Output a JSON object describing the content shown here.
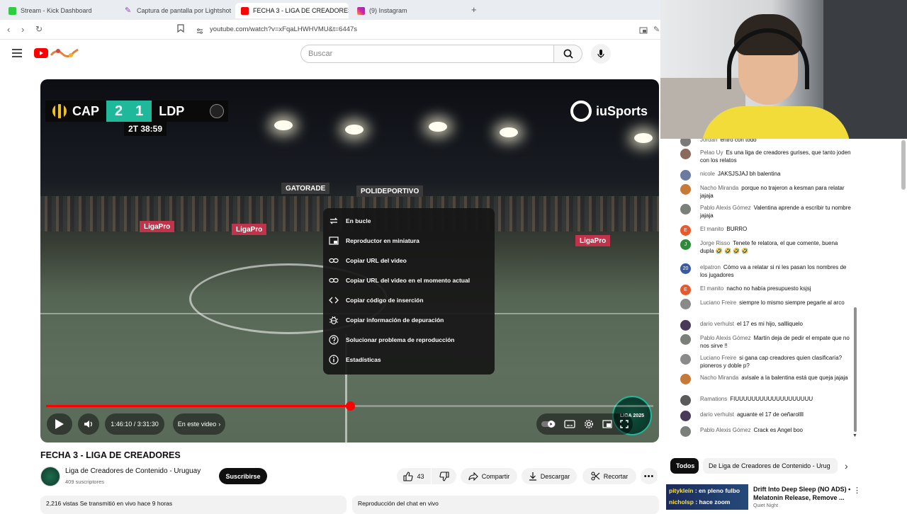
{
  "browser": {
    "tabs": [
      {
        "label": "Stream - Kick Dashboard",
        "color": "#2ecc40"
      },
      {
        "label": "Captura de pantalla por Lightshot",
        "color": "#8e44ad"
      },
      {
        "label": "FECHA 3 - LIGA DE CREADORES",
        "color": "#ff0000"
      },
      {
        "label": "(9) Instagram",
        "color": "#d6249f"
      }
    ],
    "url": "youtube.com/watch?v=xFqaLHWHVMU&t=6447s"
  },
  "header": {
    "search_placeholder": "Buscar"
  },
  "video": {
    "scoreboard": {
      "home": "CAP",
      "home_score": "2",
      "away_score": "1",
      "away": "LDP",
      "clock": "2T 38:59"
    },
    "broadcaster": "iuSports",
    "ad_boards": [
      "GATORADE",
      "POLIDEPORTIVO",
      "LigaPro",
      "LigaPro",
      "LigaPro"
    ],
    "league_badge": "LIGA 2025",
    "time_display": "1:46:10 / 3:31:30",
    "progress": 0.5,
    "chapter_label": "En este video",
    "context_menu": [
      {
        "label": "En bucle",
        "icon": "loop-icon"
      },
      {
        "label": "Reproductor en miniatura",
        "icon": "miniplayer-icon"
      },
      {
        "label": "Copiar URL del video",
        "icon": "link-icon"
      },
      {
        "label": "Copiar URL del video en el momento actual",
        "icon": "link-icon"
      },
      {
        "label": "Copiar código de inserción",
        "icon": "code-icon"
      },
      {
        "label": "Copiar información de depuración",
        "icon": "bug-icon"
      },
      {
        "label": "Solucionar problema de reproducción",
        "icon": "help-icon"
      },
      {
        "label": "Estadísticas",
        "icon": "info-icon"
      }
    ]
  },
  "below_video": {
    "title": "FECHA 3 - LIGA DE CREADORES",
    "channel_name": "Liga de Creadores de Contenido - Uruguay",
    "subscribers": "409 suscriptores",
    "subscribe_label": "Suscribirse",
    "likes": "43",
    "share_label": "Compartir",
    "download_label": "Descargar",
    "clip_label": "Recortar",
    "views_meta": "2,216 vistas  Se transmitió en vivo hace 9 horas",
    "chat_replay_label": "Reproducción del chat en vivo"
  },
  "chat": {
    "messages": [
      {
        "author": "Jordan",
        "text": "entro con todo",
        "avatar": "",
        "color": "#7a7a7a"
      },
      {
        "author": "Pelao Uy",
        "text": "Es una liga de creadores gurises, que tanto joden con los relatos",
        "avatar": "",
        "color": "#8a6a5a"
      },
      {
        "author": "nicole",
        "text": "JAKSJSJAJ bh balentina",
        "avatar": "",
        "color": "#6b7aa0"
      },
      {
        "author": "Nacho Miranda",
        "text": "porque no trajeron a kesman para relatar jajaja",
        "avatar": "",
        "color": "#c67a3a"
      },
      {
        "author": "Pablo Alexis Gómez",
        "text": "Valentina aprende a escribir tu nombre jajaja",
        "avatar": "",
        "color": "#7a7f7a"
      },
      {
        "author": "El manito",
        "text": "BURRO",
        "avatar": "E",
        "color": "#e8582a"
      },
      {
        "author": "Jorge Risso",
        "text": "Tenete fe relatora, el que comente, buena dupla 🤣 🤣 🤣 🤣",
        "avatar": "J",
        "color": "#2e8b3a"
      },
      {
        "author": "elpatron",
        "text": "Cómo va a relatar si ni les pasan los nombres de los jugadores",
        "avatar": "20",
        "color": "#3a5aa0"
      },
      {
        "author": "El manito",
        "text": "nacho no había presupuesto ksjsj",
        "avatar": "E",
        "color": "#e8582a"
      },
      {
        "author": "Luciano Freire",
        "text": "siempre lo mismo siempre pegarle al arco",
        "avatar": "",
        "color": "#8a8a8a"
      },
      {
        "author": "dario verhulst",
        "text": "el 17 es mi hijo, sallliquelo",
        "avatar": "",
        "color": "#4a3a5a"
      },
      {
        "author": "Pablo Alexis Gómez",
        "text": "Martín deja de pedir el empate que no nos sirve !!",
        "avatar": "",
        "color": "#7a7f7a"
      },
      {
        "author": "Luciano Freire",
        "text": "si gana cap creadores quien clasificaría? pioneros y doble p?",
        "avatar": "",
        "color": "#8a8a8a"
      },
      {
        "author": "Nacho Miranda",
        "text": "avisale a la balentina está que queja jajaja",
        "avatar": "",
        "color": "#c67a3a"
      },
      {
        "author": "Ramations",
        "text": "FIUUUUUUUUUUUUUUUUUUU",
        "avatar": "",
        "color": "#5a5a5a"
      },
      {
        "author": "dario verhulst",
        "text": "aguante el 17 de oeñarollll",
        "avatar": "",
        "color": "#4a3a5a"
      },
      {
        "author": "Pablo Alexis Gómez",
        "text": "Crack es Angel boo",
        "avatar": "",
        "color": "#7a7f7a"
      }
    ]
  },
  "chips": {
    "all": "Todos",
    "channel": "De Liga de Creadores de Contenido - Urug"
  },
  "related": {
    "thumb_line1_name": "pitykleín",
    "thumb_line1_text": ": en pleno fulbo",
    "thumb_line2_name": "nicholsp",
    "thumb_line2_text": ": hace zoom",
    "title": "Drift Into Deep Sleep (NO ADS) • Melatonin Release, Remove ...",
    "channel": "Quiet Night"
  }
}
